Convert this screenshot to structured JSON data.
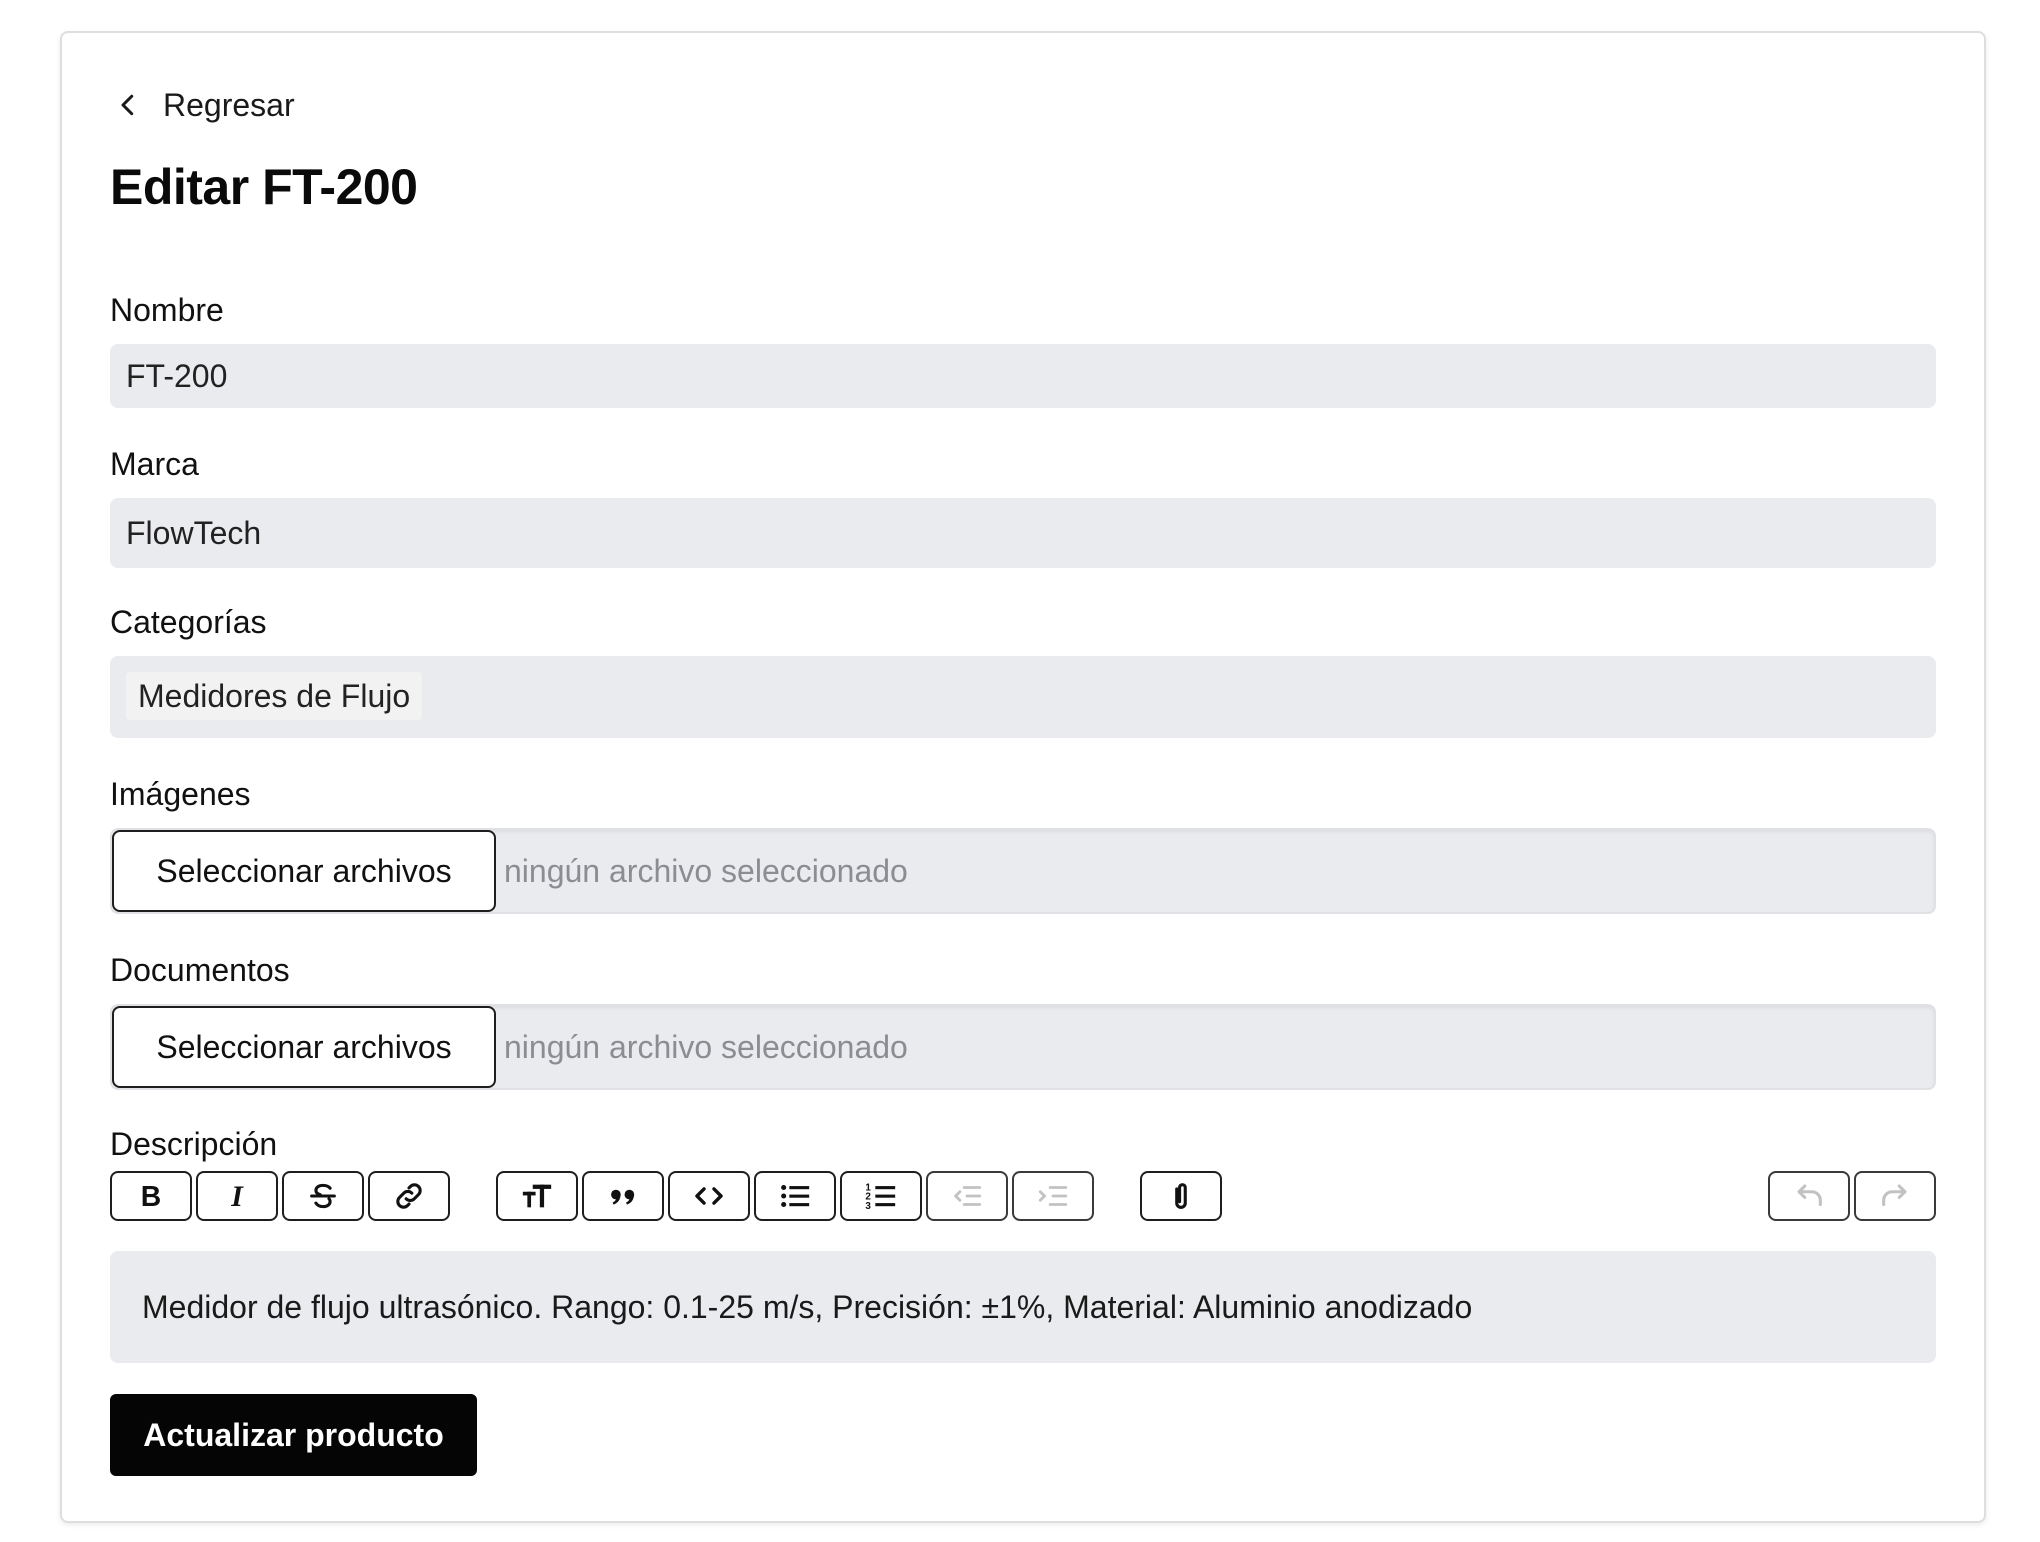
{
  "nav": {
    "back_label": "Regresar"
  },
  "page": {
    "title": "Editar FT-200"
  },
  "form": {
    "nombre": {
      "label": "Nombre",
      "value": "FT-200"
    },
    "marca": {
      "label": "Marca",
      "value": "FlowTech"
    },
    "categorias": {
      "label": "Categorías",
      "tags": [
        "Medidores de Flujo"
      ]
    },
    "imagenes": {
      "label": "Imágenes",
      "button_label": "Seleccionar archivos",
      "status": "ningún archivo seleccionado"
    },
    "documentos": {
      "label": "Documentos",
      "button_label": "Seleccionar archivos",
      "status": "ningún archivo seleccionado"
    },
    "descripcion": {
      "label": "Descripción",
      "content": "Medidor de flujo ultrasónico. Rango: 0.1-25 m/s, Precisión: ±1%, Material: Aluminio anodizado"
    },
    "submit_label": "Actualizar producto"
  },
  "toolbar": {
    "buttons": [
      {
        "icon": "bold-icon",
        "enabled": true
      },
      {
        "icon": "italic-icon",
        "enabled": true
      },
      {
        "icon": "strikethrough-icon",
        "enabled": true
      },
      {
        "icon": "link-icon",
        "enabled": true
      },
      {
        "icon": "heading-icon",
        "enabled": true
      },
      {
        "icon": "quote-icon",
        "enabled": true
      },
      {
        "icon": "code-icon",
        "enabled": true
      },
      {
        "icon": "bullet-list-icon",
        "enabled": true
      },
      {
        "icon": "numbered-list-icon",
        "enabled": true
      },
      {
        "icon": "outdent-icon",
        "enabled": false
      },
      {
        "icon": "indent-icon",
        "enabled": false
      },
      {
        "icon": "attach-icon",
        "enabled": true
      },
      {
        "icon": "undo-icon",
        "enabled": false
      },
      {
        "icon": "redo-icon",
        "enabled": false
      }
    ]
  },
  "colors": {
    "input_background": "#eaebee",
    "primary_button": "#050505",
    "placeholder_text": "#8b8d92"
  }
}
